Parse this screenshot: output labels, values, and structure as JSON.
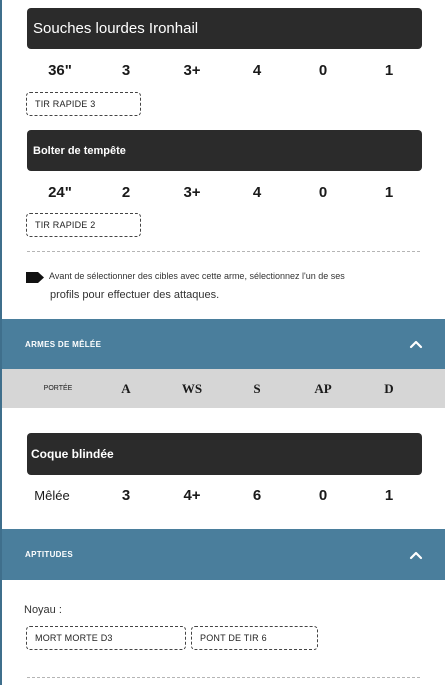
{
  "weapons": [
    {
      "name": "Souches lourdes Ironhail",
      "stats": [
        "36\"",
        "3",
        "3+",
        "4",
        "0",
        "1"
      ],
      "keyword": "TIR RAPIDE 3"
    },
    {
      "name": "Bolter de tempête",
      "stats": [
        "24\"",
        "2",
        "3+",
        "4",
        "0",
        "1"
      ],
      "keyword": "TIR RAPIDE 2"
    }
  ],
  "notice": {
    "line1": "Avant de sélectionner des cibles avec cette arme, sélectionnez l'un de ses",
    "line2": "profils pour effectuer des attaques."
  },
  "melee": {
    "section_title": "ARMES DE MÊLÉE",
    "headers": [
      "PORTÉE",
      "A",
      "WS",
      "S",
      "AP",
      "D"
    ],
    "weapon": {
      "name": "Coque blindée",
      "stats": [
        "Mêlée",
        "3",
        "4+",
        "6",
        "0",
        "1"
      ]
    }
  },
  "abilities": {
    "section_title": "APTITUDES",
    "core_label": "Noyau :",
    "core": [
      "MORT MORTE D3",
      "PONT DE TIR 6"
    ]
  },
  "colors": {
    "section_band": "#4a7e9c",
    "weapon_bar": "#2b2b2b",
    "header_row": "#d6d6d6"
  },
  "icons": {
    "notice": "arrow-tag-icon",
    "collapse": "chevron-up-icon"
  }
}
